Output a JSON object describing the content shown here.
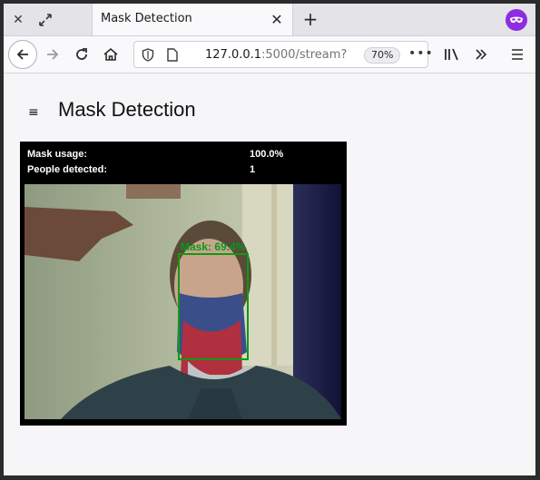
{
  "browser": {
    "tab_title": "Mask Detection",
    "url_host": "127.0.0.1",
    "url_path": ":5000/stream?",
    "zoom": "70%"
  },
  "page": {
    "title": "Mask Detection"
  },
  "stream": {
    "mask_usage_label": "Mask usage:",
    "mask_usage_value": "100.0%",
    "people_label": "People detected:",
    "people_value": "1",
    "detection_label": "Mask: 69.4%"
  }
}
